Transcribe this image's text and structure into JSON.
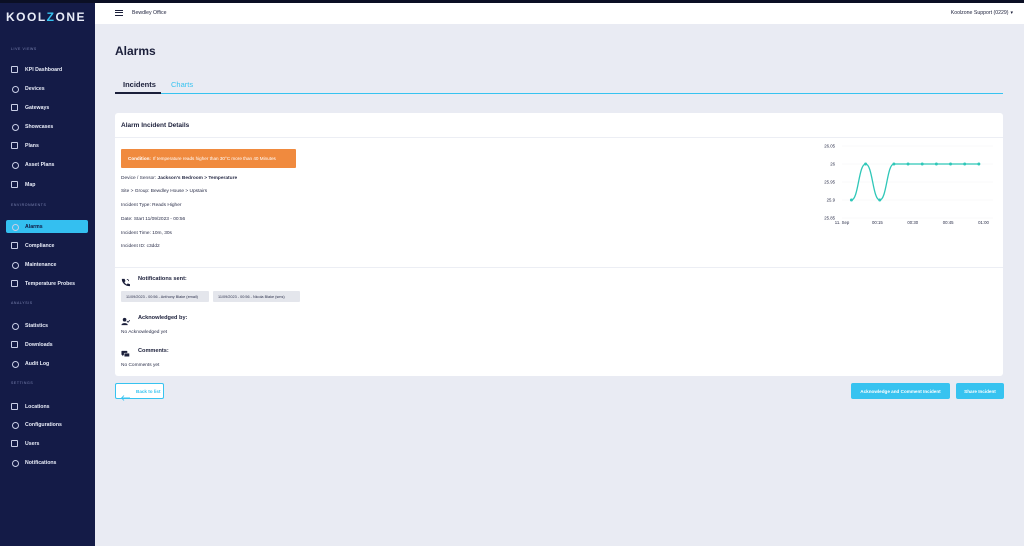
{
  "brand": {
    "logo_left": "KOOL",
    "logo_z": "Z",
    "logo_right": "ONE"
  },
  "sidebar": {
    "sections": [
      {
        "label": "LIVE VIEWS"
      },
      {
        "label": "ENVIRONMENTS"
      },
      {
        "label": "ANALYSIS"
      },
      {
        "label": "SETTINGS"
      }
    ],
    "items": [
      {
        "label": "KPI Dashboard",
        "icon": "dashboard-icon"
      },
      {
        "label": "Devices",
        "icon": "device-icon"
      },
      {
        "label": "Gateways",
        "icon": "gateway-icon"
      },
      {
        "label": "Showcases",
        "icon": "showcase-icon"
      },
      {
        "label": "Plans",
        "icon": "plans-icon"
      },
      {
        "label": "Asset Plans",
        "icon": "asset-plans-icon"
      },
      {
        "label": "Map",
        "icon": "map-icon"
      },
      {
        "label": "Alarms",
        "icon": "bell-icon",
        "active": true
      },
      {
        "label": "Compliance",
        "icon": "compliance-icon"
      },
      {
        "label": "Maintenance",
        "icon": "wifi-icon"
      },
      {
        "label": "Temperature Probes",
        "icon": "probe-icon"
      },
      {
        "label": "Statistics",
        "icon": "statistics-icon"
      },
      {
        "label": "Downloads",
        "icon": "download-icon"
      },
      {
        "label": "Audit Log",
        "icon": "audit-log-icon"
      },
      {
        "label": "Locations",
        "icon": "location-icon"
      },
      {
        "label": "Configurations",
        "icon": "gear-icon"
      },
      {
        "label": "Users",
        "icon": "users-icon"
      },
      {
        "label": "Notifications",
        "icon": "notification-icon"
      }
    ]
  },
  "topbar": {
    "site": "Bewdley Office",
    "user": "Koolzone Support (0229)"
  },
  "page": {
    "title": "Alarms"
  },
  "tabs": [
    {
      "label": "Incidents",
      "active": true
    },
    {
      "label": "Charts"
    }
  ],
  "incident": {
    "card_title": "Alarm Incident Details",
    "condition_label": "Condition:",
    "condition_text": "If temperature reads higher than 30°C more than 40 Minutes",
    "device_label": "Device / Sensor:",
    "device_value": "Jackson's Bedroom > Temperature",
    "site_label": "Site > Group:",
    "site_value": "Bewdley House > Upstairs",
    "type_label": "Incident Type:",
    "type_value": "Reads Higher",
    "date_label": "Date:",
    "date_value": "Start 11/09/2023 - 00:56",
    "time_label": "Incident Time:",
    "time_value": "10m, 30s",
    "id_label": "Incident ID:",
    "id_value": "c3dd2"
  },
  "notifications": {
    "title": "Notifications sent:",
    "chips": [
      "11/09/2023 - 00:56 - Anthony Blake (email)",
      "11/09/2023 - 00:56 - Nicola Blake (sms)"
    ]
  },
  "acknowledged": {
    "title": "Acknowledged by:",
    "text": "No Acknowledged yet"
  },
  "comments": {
    "title": "Comments:",
    "text": "No Comments yet"
  },
  "buttons": {
    "back": "Back to list",
    "acknowledge": "Acknowledge and Comment Incident",
    "share": "Share Incident"
  },
  "colors": {
    "accent": "#37c3f0",
    "sidebar": "#141b47",
    "condition": "#f08a3e",
    "line": "#2fc7b8"
  },
  "chart_data": {
    "type": "line",
    "x_tick_labels": [
      "11. Sep",
      "00:15",
      "00:30",
      "00:45",
      "01:00"
    ],
    "y_tick_labels": [
      "25.85",
      "25.9",
      "25.95",
      "26",
      "26.05"
    ],
    "ylim": [
      25.85,
      26.05
    ],
    "series": [
      {
        "points": [
          {
            "x": "00:04",
            "y": 25.9
          },
          {
            "x": "00:10",
            "y": 26
          },
          {
            "x": "00:16",
            "y": 25.9
          },
          {
            "x": "00:22",
            "y": 26
          },
          {
            "x": "00:28",
            "y": 26
          },
          {
            "x": "00:34",
            "y": 26
          },
          {
            "x": "00:40",
            "y": 26
          },
          {
            "x": "00:46",
            "y": 26
          },
          {
            "x": "00:52",
            "y": 26
          },
          {
            "x": "00:58",
            "y": 26
          }
        ]
      }
    ]
  }
}
